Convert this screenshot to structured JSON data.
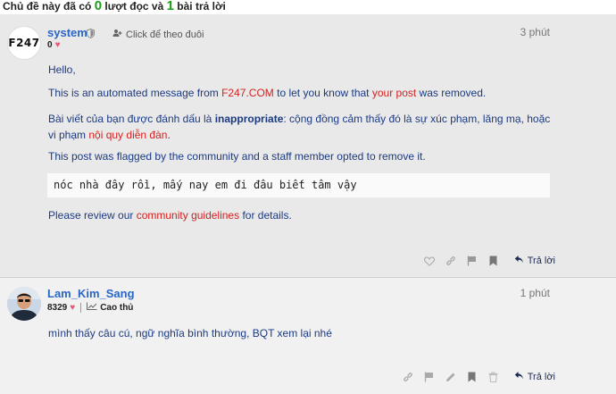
{
  "topbar": {
    "prefix": "Chủ đề này đã có ",
    "views": "0",
    "mid": " lượt đọc và ",
    "replies": "1",
    "suffix": " bài trả lời"
  },
  "post1": {
    "avatar_text": "F247",
    "username": "system",
    "follow_label": "Click để theo đuôi",
    "likes": "0",
    "time": "3 phút",
    "hello": "Hello,",
    "auto_msg_a": "This is an automated message from ",
    "auto_msg_site": "F247.COM",
    "auto_msg_b": " to let you know that ",
    "auto_msg_link": "your post",
    "auto_msg_c": " was removed.",
    "vn_a": "Bài viết của bạn được đánh dấu là ",
    "vn_bold": "inappropriate",
    "vn_b": ": cộng đồng cảm thấy đó là sự xúc phạm, lăng mạ, hoặc vi phạm ",
    "vn_link": "nội quy diễn đàn",
    "vn_c": ".",
    "flagged": "This post was flagged by the community and a staff member opted to remove it.",
    "quote": "nóc nhà đây rồi, mấy nay em đi đâu biết tâm vậy",
    "review_a": "Please review our ",
    "review_link": "community guidelines",
    "review_b": " for details.",
    "reply_label": "Trả lời"
  },
  "post2": {
    "username": "Lam_Kim_Sang",
    "likes": "8329",
    "rank": "Cao thủ",
    "time": "1 phút",
    "text": "mình thấy câu cú, ngữ nghĩa bình thường, BQT xem lại nhé",
    "reply_label": "Trả lời"
  },
  "colors": {
    "accent_green": "#1a9e1a",
    "link_red": "#d52121",
    "text_blue": "#1b3a82",
    "username_blue": "#2a66c8"
  }
}
